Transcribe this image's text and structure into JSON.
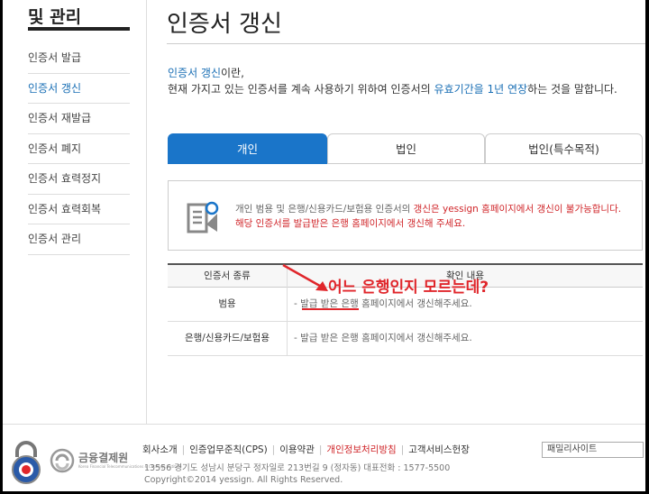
{
  "sidebar": {
    "title": "및 관리",
    "items": [
      {
        "label": "인증서 발급"
      },
      {
        "label": "인증서 갱신"
      },
      {
        "label": "인증서 재발급"
      },
      {
        "label": "인증서 폐지"
      },
      {
        "label": "인증서 효력정지"
      },
      {
        "label": "인증서 효력회복"
      },
      {
        "label": "인증서 관리"
      }
    ],
    "active_index": 1
  },
  "main": {
    "title": "인증서 갱신",
    "intro": {
      "term": "인증서 갱신",
      "term_suffix": "이란,",
      "line2_a": "현재 가지고 있는 인증서를 계속 사용하기 위하여 인증서의 ",
      "line2_hl": "유효기간을 1년 연장",
      "line2_b": "하는 것을 말합니다."
    },
    "tabs": [
      {
        "label": "개인"
      },
      {
        "label": "법인"
      },
      {
        "label": "법인(특수목적)"
      }
    ],
    "notice": {
      "line1_a": "개인 범용 및 은행/신용카드/보험용 인증서의 ",
      "line1_b": "갱신은 yessign 홈페이지에서 갱신이 불가능합니다.",
      "line2": "해당 인증서를 발급받은 은행 홈페이지에서 갱신해 주세요."
    },
    "table": {
      "headers": [
        "인증서 종류",
        "확인 내용"
      ],
      "rows": [
        {
          "type": "범용",
          "content": "- 발급 받은 은행 홈페이지에서 갱신해주세요."
        },
        {
          "type": "은행/신용카드/보험용",
          "content": "- 발급 받은 은행 홈페이지에서 갱신해주세요."
        }
      ]
    },
    "annotation": "어느 은행인지 모르는데?"
  },
  "footer": {
    "links": [
      "회사소개",
      "인증업무준칙(CPS)",
      "이용약관",
      "개인정보처리방침",
      "고객서비스헌장"
    ],
    "address": "13556 경기도 성남시 분당구 정자일로 213번길 9 (정자동) 대표전화 : 1577-5500",
    "copyright": "Copyright©2014 yessign. All Rights Reserved.",
    "family_site": "패밀리사이트",
    "ftc_name": "금융결제원",
    "ftc_sub": "Korea Financial Telecommunications & Clearings Institute"
  },
  "colors": {
    "accent": "#1a75c9",
    "alert": "#d0262a"
  }
}
